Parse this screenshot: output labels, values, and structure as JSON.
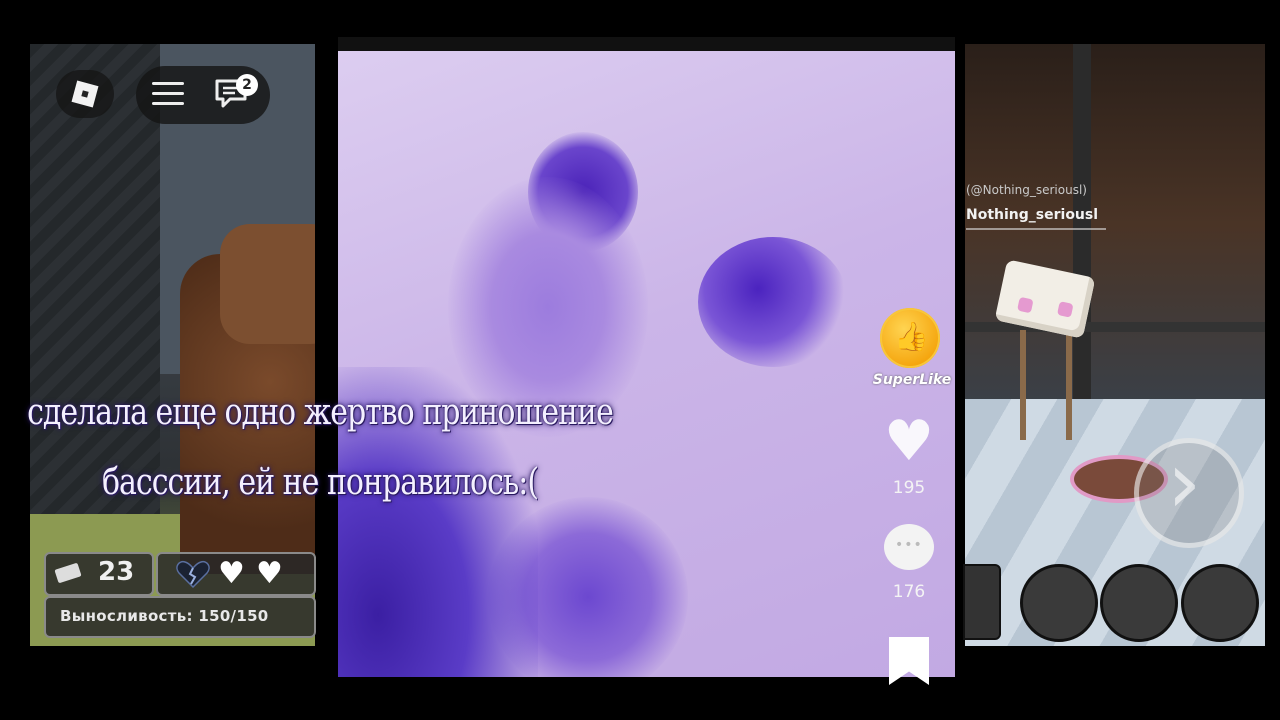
{
  "left_game": {
    "chat_badge": "2",
    "tickets": "23",
    "hearts": [
      "♥",
      "♥"
    ],
    "stamina_label": "Выносливость: 150/150"
  },
  "video": {
    "caption_line1": "сделала еще одно жертво приношение",
    "caption_line2": "басссии, ей не понравилось:(",
    "superlike_label": "SuperLike",
    "like_count": "195",
    "comment_count": "176",
    "heart_glyph": "♥"
  },
  "right_game": {
    "handle_small": "(@Nothing_seriousl)",
    "handle": "Nothing_seriousl"
  },
  "colors": {
    "accent_superlike": "#f5a60f",
    "paper": "#cbb5e8",
    "ink": "#5a3cc7"
  }
}
